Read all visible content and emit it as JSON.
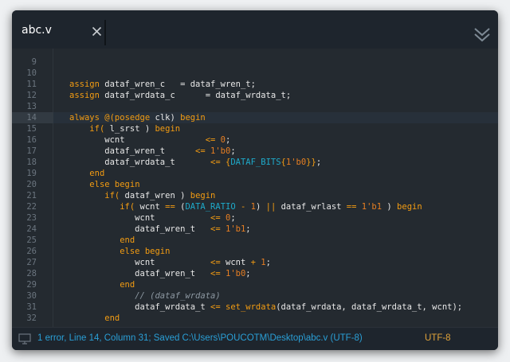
{
  "colors": {
    "background": "#1e252d",
    "editor_bg": "#242a30",
    "keyword": "#f39c12",
    "number": "#e67e22",
    "constant": "#1eaaca",
    "comment": "#8d98a2",
    "status": "#2a9fd6",
    "tab_accent": "#e0a33a"
  },
  "tab": {
    "label": "abc.v",
    "close_icon": "close-icon"
  },
  "menu_icon": "double-chevron-down-icon",
  "editor": {
    "active_line": 14,
    "lines": [
      {
        "num": "9",
        "tokens": []
      },
      {
        "num": "10",
        "tokens": []
      },
      {
        "num": "11",
        "tokens": [
          [
            "kw",
            "assign"
          ],
          [
            "txt",
            " dataf_wren_c   = dataf_wren_t;"
          ]
        ]
      },
      {
        "num": "12",
        "tokens": [
          [
            "kw",
            "assign"
          ],
          [
            "txt",
            " dataf_wrdata_c      = dataf_wrdata_t;"
          ]
        ]
      },
      {
        "num": "13",
        "tokens": []
      },
      {
        "num": "14",
        "tokens": [
          [
            "kw",
            "always"
          ],
          [
            "txt",
            " "
          ],
          [
            "kw",
            "@("
          ],
          [
            "kw",
            "posedge"
          ],
          [
            "txt",
            " clk) "
          ],
          [
            "kw",
            "begin"
          ]
        ]
      },
      {
        "num": "15",
        "tokens": [
          [
            "txt",
            "    "
          ],
          [
            "kw",
            "if("
          ],
          [
            "txt",
            " l_srst ) "
          ],
          [
            "kw",
            "begin"
          ]
        ]
      },
      {
        "num": "16",
        "tokens": [
          [
            "txt",
            "       wcnt                "
          ],
          [
            "kw",
            "<="
          ],
          [
            "txt",
            " "
          ],
          [
            "num",
            "0"
          ],
          [
            "txt",
            ";"
          ]
        ]
      },
      {
        "num": "17",
        "tokens": [
          [
            "txt",
            "       dataf_wren_t      "
          ],
          [
            "kw",
            "<="
          ],
          [
            "txt",
            " "
          ],
          [
            "num",
            "1'b0"
          ],
          [
            "txt",
            ";"
          ]
        ]
      },
      {
        "num": "18",
        "tokens": [
          [
            "txt",
            "       dataf_wrdata_t       "
          ],
          [
            "kw",
            "<="
          ],
          [
            "txt",
            " "
          ],
          [
            "kw",
            "{"
          ],
          [
            "cst",
            "DATAF_BITS"
          ],
          [
            "kw",
            "{"
          ],
          [
            "num",
            "1'b0"
          ],
          [
            "kw",
            "}}"
          ],
          [
            "txt",
            ";"
          ]
        ]
      },
      {
        "num": "19",
        "tokens": [
          [
            "txt",
            "    "
          ],
          [
            "kw",
            "end"
          ]
        ]
      },
      {
        "num": "20",
        "tokens": [
          [
            "txt",
            "    "
          ],
          [
            "kw",
            "else begin"
          ]
        ]
      },
      {
        "num": "21",
        "tokens": [
          [
            "txt",
            "       "
          ],
          [
            "kw",
            "if("
          ],
          [
            "txt",
            " dataf_wren ) "
          ],
          [
            "kw",
            "begin"
          ]
        ]
      },
      {
        "num": "22",
        "tokens": [
          [
            "txt",
            "          "
          ],
          [
            "kw",
            "if("
          ],
          [
            "txt",
            " wcnt "
          ],
          [
            "kw",
            "=="
          ],
          [
            "txt",
            " ("
          ],
          [
            "cst",
            "DATA_RATIO"
          ],
          [
            "txt",
            " "
          ],
          [
            "kw",
            "-"
          ],
          [
            "txt",
            " "
          ],
          [
            "num",
            "1"
          ],
          [
            "txt",
            ") "
          ],
          [
            "kw",
            "||"
          ],
          [
            "txt",
            " dataf_wrlast "
          ],
          [
            "kw",
            "=="
          ],
          [
            "txt",
            " "
          ],
          [
            "num",
            "1'b1"
          ],
          [
            "txt",
            " ) "
          ],
          [
            "kw",
            "begin"
          ]
        ]
      },
      {
        "num": "23",
        "tokens": [
          [
            "txt",
            "             wcnt           "
          ],
          [
            "kw",
            "<="
          ],
          [
            "txt",
            " "
          ],
          [
            "num",
            "0"
          ],
          [
            "txt",
            ";"
          ]
        ]
      },
      {
        "num": "24",
        "tokens": [
          [
            "txt",
            "             dataf_wren_t   "
          ],
          [
            "kw",
            "<="
          ],
          [
            "txt",
            " "
          ],
          [
            "num",
            "1'b1"
          ],
          [
            "txt",
            ";"
          ]
        ]
      },
      {
        "num": "25",
        "tokens": [
          [
            "txt",
            "          "
          ],
          [
            "kw",
            "end"
          ]
        ]
      },
      {
        "num": "26",
        "tokens": [
          [
            "txt",
            "          "
          ],
          [
            "kw",
            "else begin"
          ]
        ]
      },
      {
        "num": "27",
        "tokens": [
          [
            "txt",
            "             wcnt           "
          ],
          [
            "kw",
            "<="
          ],
          [
            "txt",
            " wcnt "
          ],
          [
            "kw",
            "+"
          ],
          [
            "txt",
            " "
          ],
          [
            "num",
            "1"
          ],
          [
            "txt",
            ";"
          ]
        ]
      },
      {
        "num": "28",
        "tokens": [
          [
            "txt",
            "             dataf_wren_t   "
          ],
          [
            "kw",
            "<="
          ],
          [
            "txt",
            " "
          ],
          [
            "num",
            "1'b0"
          ],
          [
            "txt",
            ";"
          ]
        ]
      },
      {
        "num": "29",
        "tokens": [
          [
            "txt",
            "          "
          ],
          [
            "kw",
            "end"
          ]
        ]
      },
      {
        "num": "30",
        "tokens": [
          [
            "txt",
            "             "
          ],
          [
            "cm",
            "// (dataf_wrdata)"
          ]
        ]
      },
      {
        "num": "31",
        "tokens": [
          [
            "txt",
            "             dataf_wrdata_t "
          ],
          [
            "kw",
            "<="
          ],
          [
            "txt",
            " "
          ],
          [
            "fn",
            "set_wrdata"
          ],
          [
            "txt",
            "(dataf_wrdata, dataf_wrdata_t, wcnt);"
          ]
        ]
      },
      {
        "num": "32",
        "tokens": [
          [
            "txt",
            "       "
          ],
          [
            "kw",
            "end"
          ]
        ]
      }
    ]
  },
  "status": {
    "icon": "monitor-icon",
    "text": "1 error, Line 14, Column 31; Saved C:\\Users\\POUCOTM\\Desktop\\abc.v (UTF-8)",
    "encoding": "UTF-8"
  }
}
